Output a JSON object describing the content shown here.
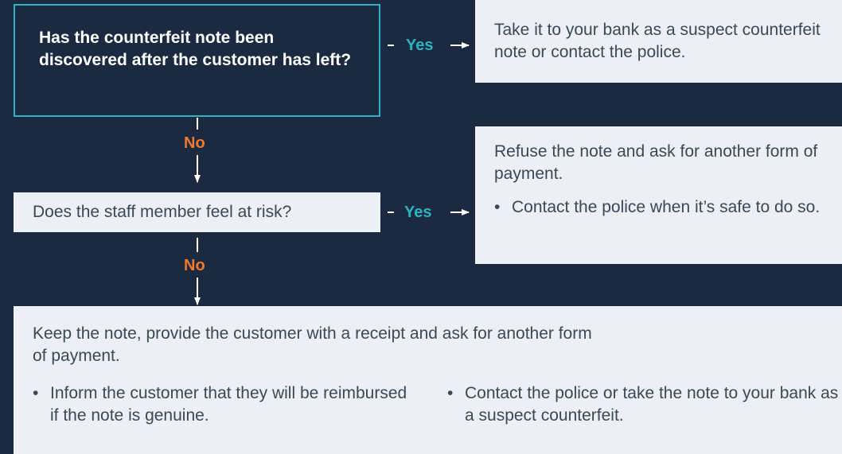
{
  "q1": {
    "text": "Has the counterfeit note been discovered after the customer has left?"
  },
  "q1_yes": {
    "label": "Yes",
    "text": "Take it to your bank as a suspect counterfeit note or contact the police."
  },
  "q1_no": {
    "label": "No"
  },
  "q2": {
    "text": "Does the staff member feel at risk?"
  },
  "q2_yes": {
    "label": "Yes",
    "text": "Refuse the note and ask for another form of payment.",
    "bullet": "Contact the police when it’s safe to do so."
  },
  "q2_no": {
    "label": "No"
  },
  "outcome": {
    "text": "Keep the note, provide the customer with a receipt and ask for another form of payment.",
    "bullets": [
      "Inform the customer that they will be reimbursed if the note is genuine.",
      "Contact the police or take the note to your bank as a suspect counterfeit."
    ]
  },
  "colors": {
    "background": "#1b2a40",
    "box": "#eceff3",
    "accent_teal": "#2bb3c0",
    "accent_orange": "#f0792b",
    "text_dark": "#3d4757"
  }
}
